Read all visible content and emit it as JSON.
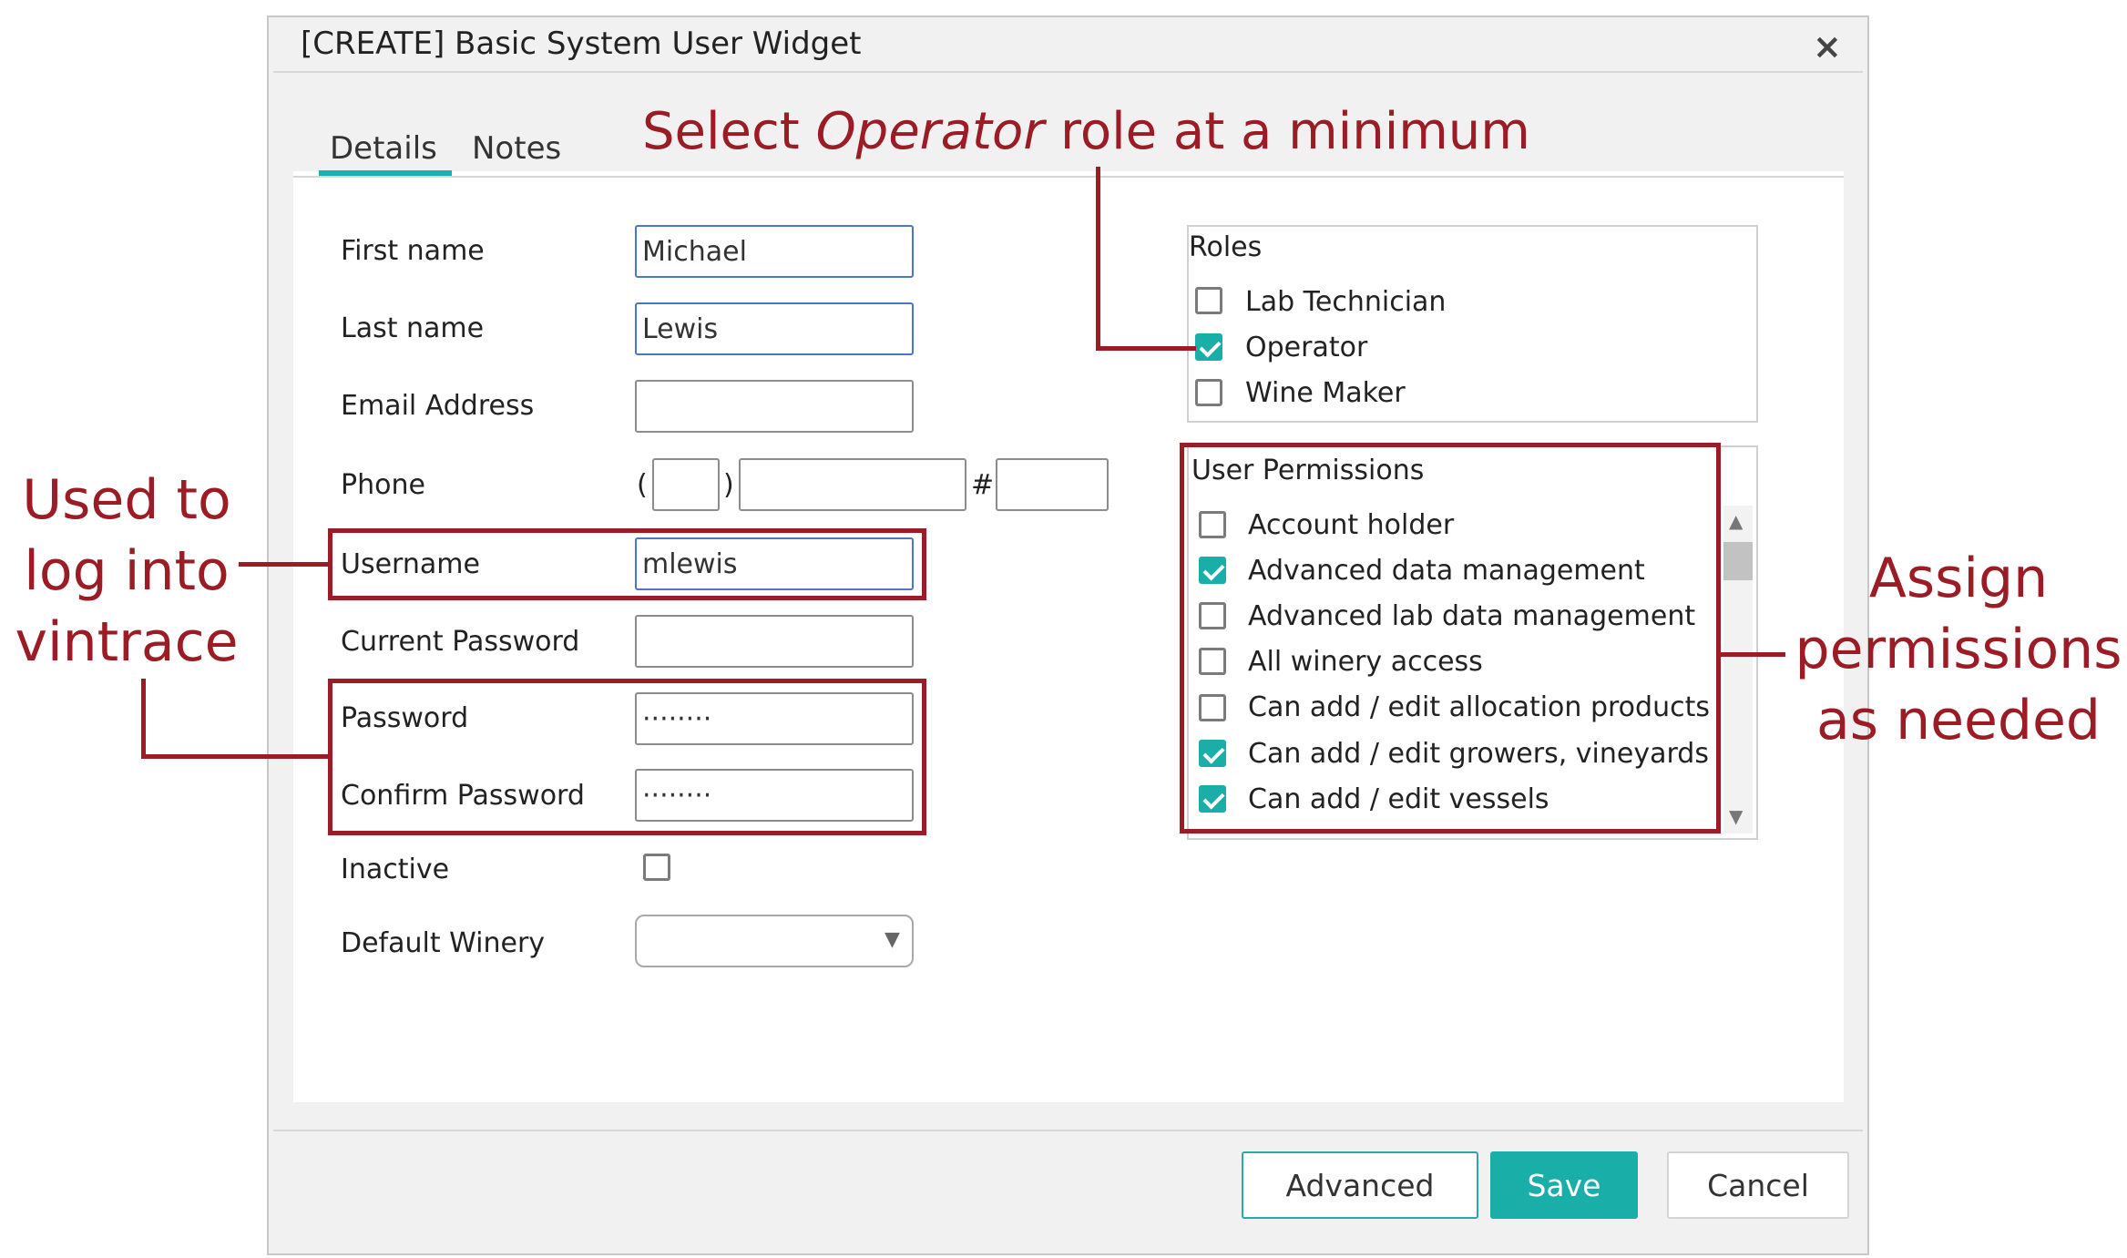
{
  "dialog": {
    "title": "[CREATE] Basic System User Widget",
    "close_icon": "×"
  },
  "tabs": [
    {
      "label": "Details",
      "active": true
    },
    {
      "label": "Notes",
      "active": false
    }
  ],
  "form": {
    "first_name": {
      "label": "First name",
      "value": "Michael"
    },
    "last_name": {
      "label": "Last name",
      "value": "Lewis"
    },
    "email": {
      "label": "Email Address",
      "value": ""
    },
    "phone": {
      "label": "Phone",
      "open_paren": "(",
      "close_paren": ")",
      "ext_sign": "#"
    },
    "username": {
      "label": "Username",
      "value": "mlewis"
    },
    "current_password": {
      "label": "Current Password",
      "value": ""
    },
    "password": {
      "label": "Password",
      "value": "········"
    },
    "confirm_password": {
      "label": "Confirm Password",
      "value": "········"
    },
    "inactive": {
      "label": "Inactive",
      "checked": false
    },
    "default_winery": {
      "label": "Default Winery",
      "value": "",
      "arrow": "▼"
    }
  },
  "roles": {
    "heading": "Roles",
    "items": [
      {
        "label": "Lab Technician",
        "checked": false
      },
      {
        "label": "Operator",
        "checked": true
      },
      {
        "label": "Wine Maker",
        "checked": false
      }
    ]
  },
  "permissions": {
    "heading": "User Permissions",
    "items": [
      {
        "label": "Account holder",
        "checked": false
      },
      {
        "label": "Advanced data management",
        "checked": true
      },
      {
        "label": "Advanced lab data management",
        "checked": false
      },
      {
        "label": "All winery access",
        "checked": false
      },
      {
        "label": "Can add / edit allocation products",
        "checked": false
      },
      {
        "label": "Can add / edit growers, vineyards",
        "checked": true
      },
      {
        "label": "Can add / edit vessels",
        "checked": true
      }
    ],
    "scroll_up": "▲",
    "scroll_down": "▼"
  },
  "buttons": {
    "advanced": "Advanced",
    "save": "Save",
    "cancel": "Cancel"
  },
  "annotations": {
    "operator_pre": "Select ",
    "operator_em": "Operator",
    "operator_post": " role at a minimum",
    "login_lines": [
      "Used to",
      "log into",
      "vintrace"
    ],
    "permissions_lines": [
      "Assign",
      "permissions",
      "as needed"
    ]
  },
  "colors": {
    "accent": "#1aaea9",
    "annotation": "#9b1c25"
  }
}
